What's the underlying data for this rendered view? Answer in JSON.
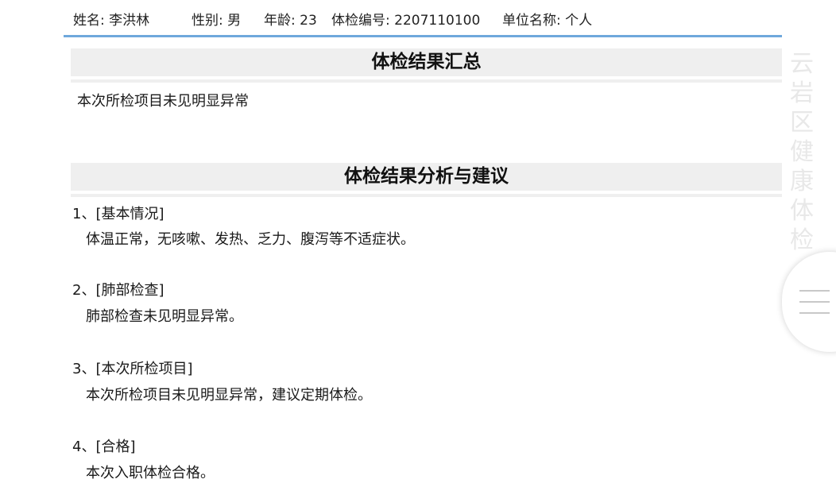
{
  "header": {
    "name": "姓名: 李洪林",
    "gender": "性别: 男",
    "age": "年龄: 23",
    "exam_no": "体检编号: 2207110100",
    "unit": "单位名称: 个人"
  },
  "summary": {
    "title": "体检结果汇总",
    "text": "本次所检项目未见明显异常"
  },
  "analysis": {
    "title": "体检结果分析与建议",
    "items": [
      {
        "title": "1、[基本情况]",
        "body": "体温正常，无咳嗽、发热、乏力、腹泻等不适症状。"
      },
      {
        "title": "2、[肺部检查]",
        "body": "肺部检查未见明显异常。"
      },
      {
        "title": "3、[本次所检项目]",
        "body": "本次所检项目未见明显异常，建议定期体检。"
      },
      {
        "title": "4、[合格]",
        "body": "本次入职体检合格。"
      }
    ]
  },
  "watermark": [
    "云",
    "岩",
    "区",
    "健",
    "康",
    "体",
    "检"
  ],
  "colors": {
    "header_rule": "#6fa8dc",
    "section_bar": "#efefef"
  },
  "icons": {
    "menu": "hamburger-menu-icon"
  }
}
